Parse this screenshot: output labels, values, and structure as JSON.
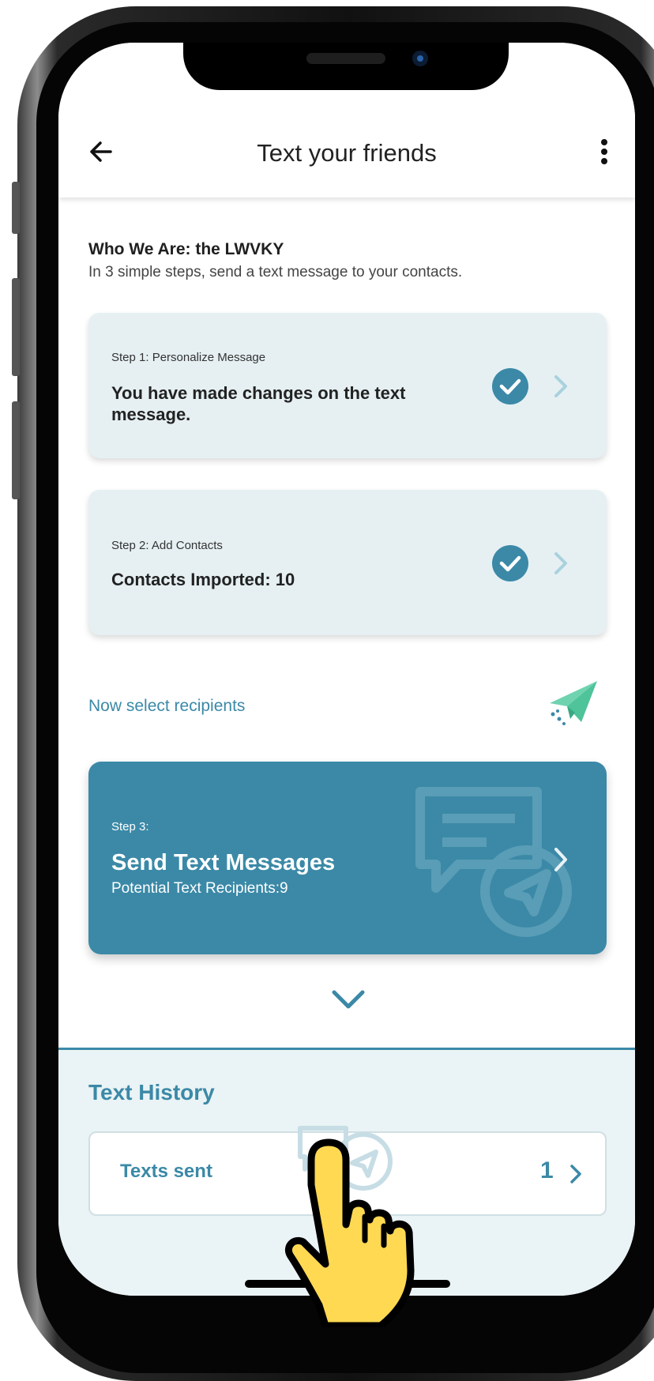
{
  "header": {
    "title": "Text your friends",
    "back_icon": "arrow-left-icon",
    "menu_icon": "more-vertical-icon"
  },
  "intro": {
    "heading": "Who We Are: the LWVKY",
    "subtitle": "In 3 simple steps, send a text message to your contacts."
  },
  "steps": [
    {
      "label": "Step 1: Personalize Message",
      "text": "You have made changes on the text message.",
      "status_icon": "check-circle-icon",
      "completed": true
    },
    {
      "label": "Step 2: Add Contacts",
      "text": "Contacts Imported:  10",
      "status_icon": "check-circle-icon",
      "completed": true
    }
  ],
  "select_recipients": {
    "label": "Now select recipients",
    "icon": "paper-plane-icon"
  },
  "step3": {
    "label": "Step 3:",
    "title": "Send Text Messages",
    "subtitle": "Potential Text Recipients:9"
  },
  "history": {
    "title": "Text History",
    "rows": [
      {
        "label": "Texts sent",
        "count": "1"
      }
    ]
  },
  "colors": {
    "accent": "#3b89a7",
    "card_bg": "#e6f0f3",
    "history_bg": "#eaf3f5",
    "plane_green": "#6fd3b0",
    "hand_yellow": "#ffd952"
  }
}
